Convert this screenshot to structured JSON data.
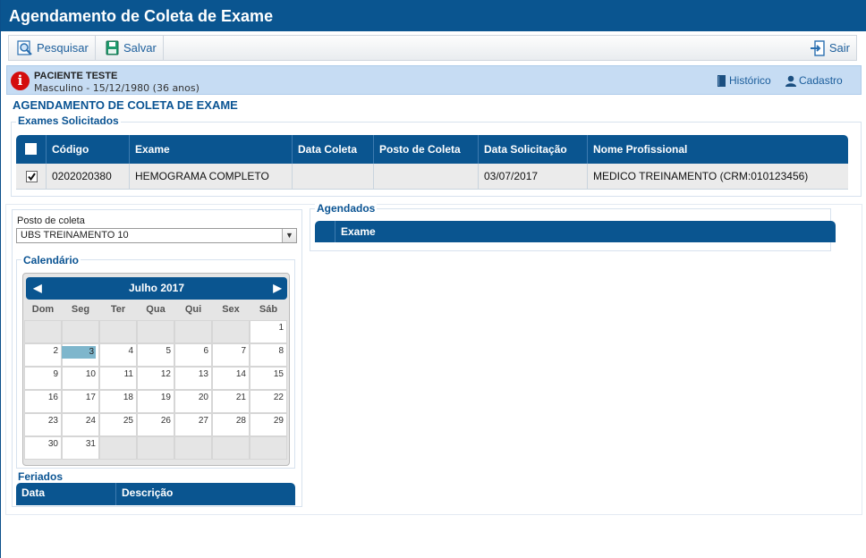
{
  "window": {
    "title": "Agendamento de Coleta de Exame"
  },
  "toolbar": {
    "search_label": "Pesquisar",
    "save_label": "Salvar",
    "exit_label": "Sair"
  },
  "patient": {
    "name": "PACIENTE TESTE",
    "details": "Masculino - 15/12/1980 (36 anos)",
    "history_label": "Histórico",
    "register_label": "Cadastro"
  },
  "page": {
    "title": "AGENDAMENTO DE COLETA DE EXAME"
  },
  "requested_exams": {
    "legend": "Exames Solicitados",
    "columns": [
      "Código",
      "Exame",
      "Data Coleta",
      "Posto de Coleta",
      "Data Solicitação",
      "Nome Profissional"
    ],
    "rows": [
      {
        "checked": true,
        "code": "0202020380",
        "exam": "HEMOGRAMA COMPLETO",
        "collect_date": "",
        "post": "",
        "request_date": "03/07/2017",
        "professional": "MEDICO TREINAMENTO (CRM:010123456)"
      }
    ]
  },
  "post": {
    "label": "Posto de coleta",
    "selected": "UBS TREINAMENTO 10"
  },
  "calendar": {
    "legend": "Calendário",
    "month_label": "Julho 2017",
    "weekdays": [
      "Dom",
      "Seg",
      "Ter",
      "Qua",
      "Qui",
      "Sex",
      "Sáb"
    ],
    "first_weekday_index": 6,
    "days_in_month": 31,
    "selected_day": 3
  },
  "holidays": {
    "legend": "Feriados",
    "columns": [
      "Data",
      "Descrição"
    ]
  },
  "scheduled": {
    "legend": "Agendados",
    "columns": [
      "Exame"
    ]
  },
  "colors": {
    "primary": "#0a5590",
    "info_bar": "#c6dcf3",
    "selected_day": "#7eb6cc",
    "alert": "#d40d0d"
  }
}
